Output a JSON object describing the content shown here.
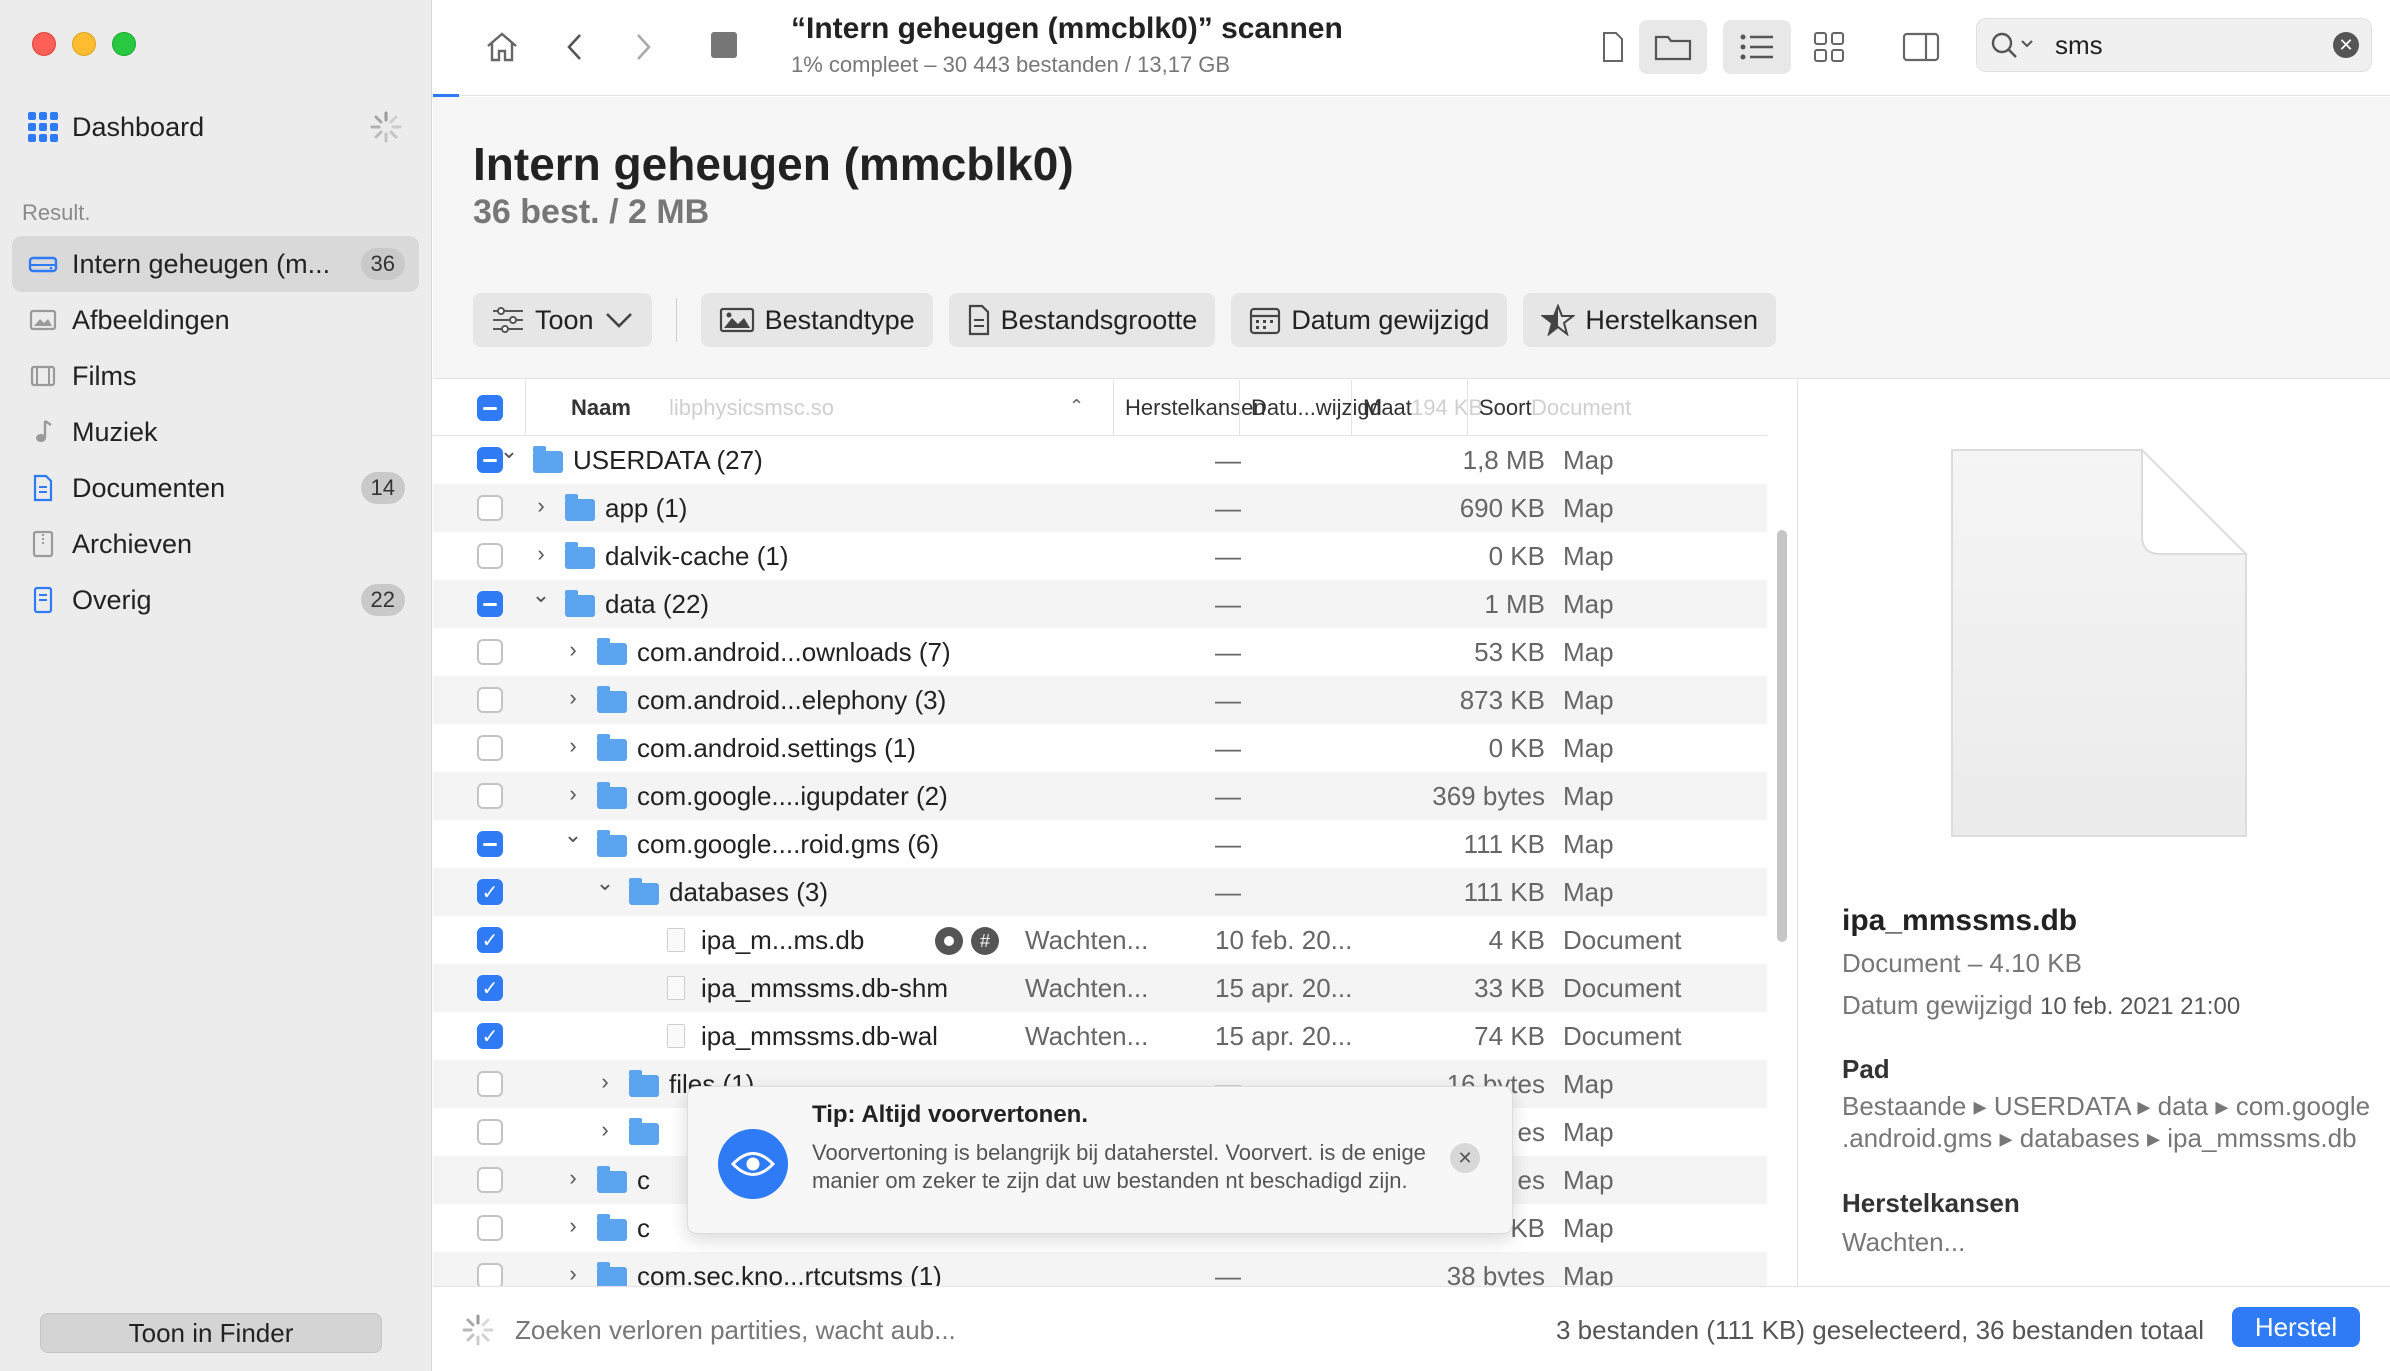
{
  "sidebar": {
    "dashboard": "Dashboard",
    "section_label": "Result.",
    "items": [
      {
        "label": "Intern geheugen (m...",
        "badge": "36",
        "icon": "drive-icon",
        "active": true
      },
      {
        "label": "Afbeeldingen",
        "badge": "",
        "icon": "image-icon"
      },
      {
        "label": "Films",
        "badge": "",
        "icon": "film-icon"
      },
      {
        "label": "Muziek",
        "badge": "",
        "icon": "music-icon"
      },
      {
        "label": "Documenten",
        "badge": "14",
        "icon": "document-icon"
      },
      {
        "label": "Archieven",
        "badge": "",
        "icon": "archive-icon"
      },
      {
        "label": "Overig",
        "badge": "22",
        "icon": "other-icon"
      }
    ],
    "finder_button": "Toon in Finder"
  },
  "toolbar": {
    "title": "“Intern geheugen (mmcblk0)” scannen",
    "subtitle": "1% compleet – 30 443 bestanden / 13,17 GB",
    "search_value": "sms",
    "progress_fraction": 0.01
  },
  "header": {
    "title": "Intern geheugen (mmcblk0)",
    "subtitle": "36 best. / 2 MB",
    "filters": {
      "toon": "Toon",
      "bestandtype": "Bestandtype",
      "bestandsgrootte": "Bestandsgrootte",
      "datum": "Datum gewijzigd",
      "herstelkansen": "Herstelkansen"
    }
  },
  "table": {
    "columns": {
      "naam": "Naam",
      "herstelkansen": "Herstelkansen",
      "datum": "Datu...wijzigd",
      "maat": "Maat",
      "soort": "Soort"
    },
    "ghost_header": {
      "name": "libphysicsmsc.so",
      "size": "194 KB",
      "kind": "Document"
    },
    "rows": [
      {
        "name": "USERDATA (27)",
        "h": "",
        "d": "—",
        "s": "1,8 MB",
        "k": "Map"
      },
      {
        "name": "app (1)",
        "h": "",
        "d": "—",
        "s": "690 KB",
        "k": "Map"
      },
      {
        "name": "dalvik-cache (1)",
        "h": "",
        "d": "—",
        "s": "0 KB",
        "k": "Map"
      },
      {
        "name": "data (22)",
        "h": "",
        "d": "—",
        "s": "1 MB",
        "k": "Map"
      },
      {
        "name": "com.android...ownloads (7)",
        "h": "",
        "d": "—",
        "s": "53 KB",
        "k": "Map"
      },
      {
        "name": "com.android...elephony (3)",
        "h": "",
        "d": "—",
        "s": "873 KB",
        "k": "Map"
      },
      {
        "name": "com.android.settings (1)",
        "h": "",
        "d": "—",
        "s": "0 KB",
        "k": "Map"
      },
      {
        "name": "com.google....igupdater (2)",
        "h": "",
        "d": "—",
        "s": "369 bytes",
        "k": "Map"
      },
      {
        "name": "com.google....roid.gms (6)",
        "h": "",
        "d": "—",
        "s": "111 KB",
        "k": "Map"
      },
      {
        "name": "databases (3)",
        "h": "",
        "d": "—",
        "s": "111 KB",
        "k": "Map"
      },
      {
        "name": "ipa_m...ms.db",
        "h": "Wachten...",
        "d": "10 feb. 20...",
        "s": "4 KB",
        "k": "Document"
      },
      {
        "name": "ipa_mmssms.db-shm",
        "h": "Wachten...",
        "d": "15 apr. 20...",
        "s": "33 KB",
        "k": "Document"
      },
      {
        "name": "ipa_mmssms.db-wal",
        "h": "Wachten...",
        "d": "15 apr. 20...",
        "s": "74 KB",
        "k": "Document"
      },
      {
        "name": "files (1)",
        "h": "",
        "d": "—",
        "s": "16 bytes",
        "k": "Map"
      },
      {
        "name": "",
        "h": "",
        "d": "",
        "s": "es",
        "k": "Map"
      },
      {
        "name": "c",
        "h": "",
        "d": "",
        "s": "es",
        "k": "Map"
      },
      {
        "name": "c",
        "h": "",
        "d": "",
        "s": "KB",
        "k": "Map"
      },
      {
        "name": "com.sec.kno...rtcutsms (1)",
        "h": "",
        "d": "—",
        "s": "38 bytes",
        "k": "Map"
      }
    ]
  },
  "tip": {
    "title": "Tip: Altijd voorvertonen.",
    "text": "Voorvertoning is belangrijk bij dataherstel. Voorvert. is de enige manier om zeker te zijn dat uw bestanden nt beschadigd zijn."
  },
  "preview": {
    "name": "ipa_mmssms.db",
    "kind": "Document – 4.10 KB",
    "date_label": "Datum gewijzigd",
    "date_value": "10 feb. 2021 21:00",
    "path_label": "Pad",
    "path_value": "Bestaande ▸ USERDATA ▸ data ▸ com.google .android.gms ▸ databases ▸ ipa_mmssms.db",
    "recovery_label": "Herstelkansen",
    "recovery_value": "Wachten..."
  },
  "status": {
    "left": "Zoeken verloren partities, wacht aub...",
    "right": "3 bestanden (111 KB) geselecteerd, 36 bestanden totaal",
    "button": "Herstel"
  },
  "colors": {
    "accent": "#2f7bf6",
    "folder": "#5aa4f0",
    "sidebar": "#ececec"
  }
}
